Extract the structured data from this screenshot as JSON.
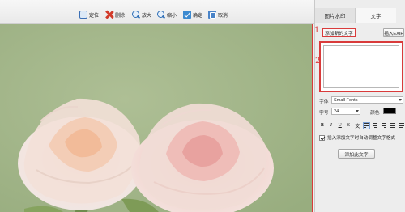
{
  "toolbar": {
    "locate": "定位",
    "delete": "删除",
    "zoom_in": "放大",
    "zoom_out": "缩小",
    "confirm": "确定",
    "cancel": "取消"
  },
  "panel": {
    "tabs": [
      "图片水印",
      "文字"
    ],
    "active_tab": "文字",
    "add_text_label": "添加新的文字",
    "insert_exif": "插入EXIF",
    "textarea_value": "",
    "font_label": "字体",
    "font_value": "Small Fonts",
    "size_label": "字号",
    "size_value": "24",
    "color_label": "颜色",
    "color_value": "#000000",
    "format_buttons": [
      "B",
      "I",
      "U",
      "S",
      "文"
    ],
    "checkbox_label": "插入添加文字时自动调整文字格式",
    "checkbox_checked": true,
    "add_button": "添加此文字"
  },
  "annotations": {
    "one": "1",
    "two": "2"
  },
  "colors": {
    "annotation_red": "#d93b3b",
    "canvas_bg": "#a2b689"
  }
}
